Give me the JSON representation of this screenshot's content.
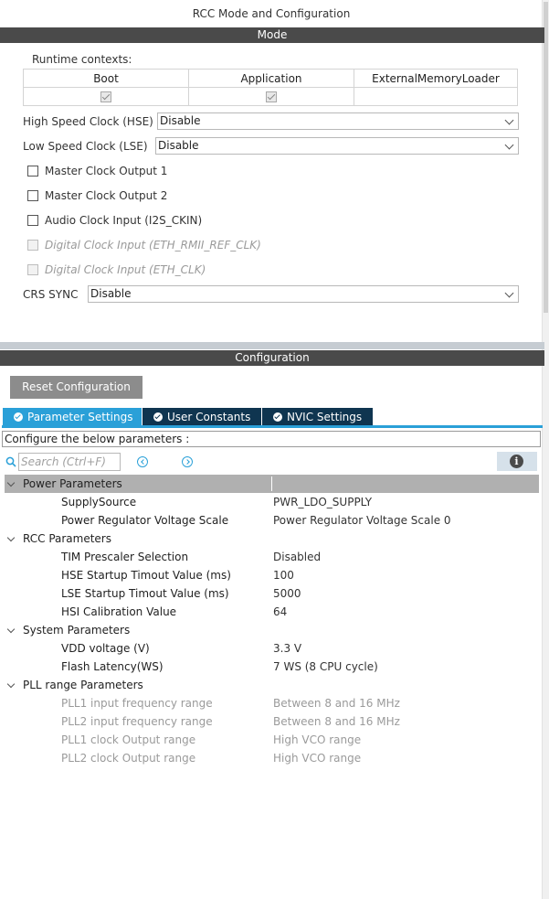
{
  "window": {
    "title": "RCC Mode and Configuration"
  },
  "mode": {
    "header": "Mode",
    "runtime_contexts": {
      "label": "Runtime contexts:",
      "columns": [
        "Boot",
        "Application",
        "ExternalMemoryLoader"
      ],
      "checked": [
        true,
        true,
        false
      ]
    },
    "hse": {
      "label": "High Speed Clock (HSE)",
      "value": "Disable"
    },
    "lse": {
      "label": "Low Speed Clock (LSE)",
      "value": "Disable"
    },
    "checkboxes": [
      {
        "label": "Master Clock Output 1",
        "enabled": true,
        "checked": false
      },
      {
        "label": "Master Clock Output 2",
        "enabled": true,
        "checked": false
      },
      {
        "label": "Audio Clock Input (I2S_CKIN)",
        "enabled": true,
        "checked": false
      },
      {
        "label": "Digital Clock Input (ETH_RMII_REF_CLK)",
        "enabled": false,
        "checked": false
      },
      {
        "label": "Digital Clock Input (ETH_CLK)",
        "enabled": false,
        "checked": false
      }
    ],
    "crs_sync": {
      "label": "CRS SYNC",
      "value": "Disable"
    }
  },
  "configuration": {
    "header": "Configuration",
    "reset_label": "Reset Configuration",
    "tabs": [
      {
        "label": "Parameter Settings",
        "active": true
      },
      {
        "label": "User Constants",
        "active": false
      },
      {
        "label": "NVIC Settings",
        "active": false
      }
    ],
    "instructions": "Configure the below parameters :",
    "search_placeholder": "Search (Ctrl+F)",
    "info_label": "i",
    "groups": [
      {
        "name": "Power Parameters",
        "params": [
          {
            "name": "SupplySource",
            "value": "PWR_LDO_SUPPLY"
          },
          {
            "name": "Power Regulator Voltage Scale",
            "value": "Power Regulator Voltage Scale 0"
          }
        ]
      },
      {
        "name": "RCC Parameters",
        "params": [
          {
            "name": "TIM Prescaler Selection",
            "value": "Disabled"
          },
          {
            "name": "HSE Startup Timout Value (ms)",
            "value": "100"
          },
          {
            "name": "LSE Startup Timout Value (ms)",
            "value": "5000"
          },
          {
            "name": "HSI Calibration Value",
            "value": "64"
          }
        ]
      },
      {
        "name": "System Parameters",
        "params": [
          {
            "name": "VDD voltage (V)",
            "value": "3.3 V"
          },
          {
            "name": "Flash Latency(WS)",
            "value": "7 WS (8 CPU cycle)"
          }
        ]
      },
      {
        "name": "PLL range Parameters",
        "params": [
          {
            "name": "PLL1 input frequency range",
            "value": "Between 8 and 16 MHz"
          },
          {
            "name": "PLL2 input frequency range",
            "value": "Between 8 and 16 MHz"
          },
          {
            "name": "PLL1 clock Output range",
            "value": "High VCO range"
          },
          {
            "name": "PLL2 clock Output range",
            "value": "High VCO range"
          }
        ]
      }
    ]
  },
  "colors": {
    "section_bar": "#4a4a4a",
    "tab_active": "#2aa0d8",
    "tab_inactive": "#0f3550",
    "group_header": "#b0b0b0",
    "reset_button": "#8c8c8c"
  }
}
